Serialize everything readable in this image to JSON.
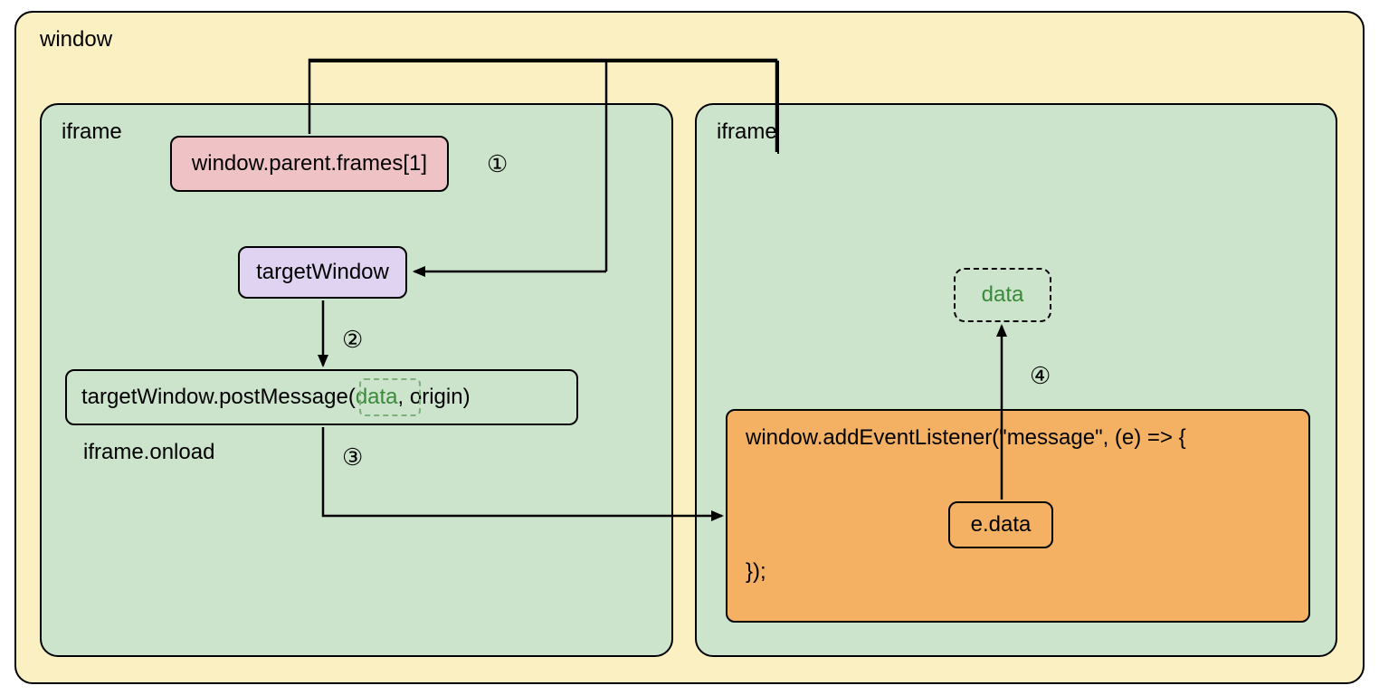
{
  "window": {
    "label": "window"
  },
  "iframeLeft": {
    "label": "iframe",
    "parentFrames": "window.parent.frames[1]",
    "targetWindow": "targetWindow",
    "postMessagePrefix": "targetWindow.postMessage(",
    "postMessageData": "data",
    "postMessageSuffix": ", origin)",
    "onload": "iframe.onload"
  },
  "iframeRight": {
    "label": "iframe",
    "dataNode": "data",
    "listenerHead": "window.addEventListener(\"message\", (e) => {",
    "eData": "e.data",
    "listenerTail": "});"
  },
  "steps": {
    "s1": "①",
    "s2": "②",
    "s3": "③",
    "s4": "④"
  },
  "colors": {
    "windowBg": "#fbf0c1",
    "iframeBg": "#cce3cc",
    "pinkBg": "#efc2c6",
    "purpleBg": "#e0d3f2",
    "orangeBg": "#f4b063"
  }
}
